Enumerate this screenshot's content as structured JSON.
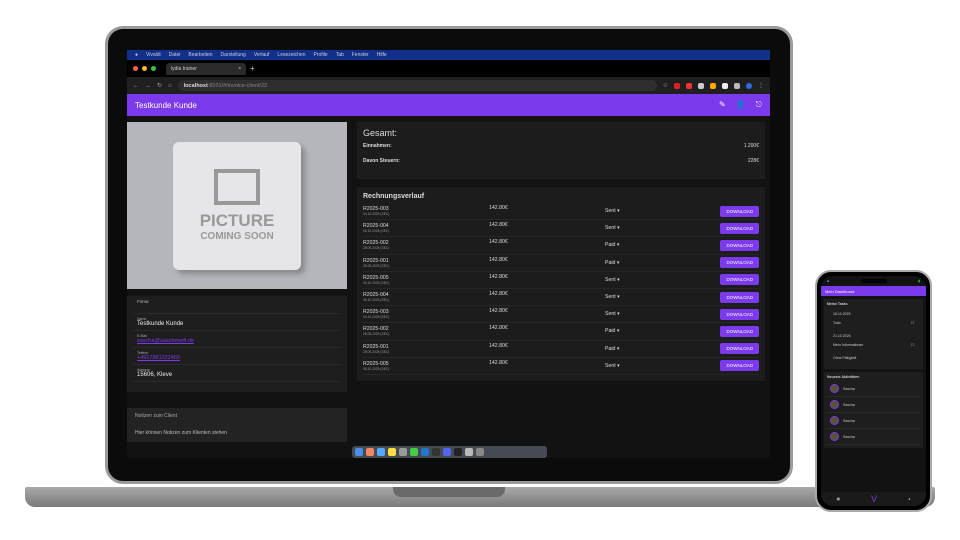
{
  "menubar": {
    "items": [
      "Vivaldi",
      "Datei",
      "Bearbeiten",
      "Darstellung",
      "Verlauf",
      "Lesezeichen",
      "Profile",
      "Tab",
      "Fenster",
      "Hilfe"
    ]
  },
  "browser": {
    "tab_title": "lydia trainer",
    "url_host": "localhost",
    "url_path": ":8101/#/invoice-client/22"
  },
  "app": {
    "title": "Testkunde Kunde",
    "accent": "#7c3aed"
  },
  "client": {
    "picture": {
      "line1": "PICTURE",
      "line2": "COMING SOON"
    },
    "fields": [
      {
        "label": "Firma",
        "value": ""
      },
      {
        "label": "Name",
        "value": "Testkunde Kunde"
      },
      {
        "label": "E-Mail",
        "value": "sascha@saschesoft.de",
        "link": true
      },
      {
        "label": "Telefon",
        "value": "+4917881222465",
        "link": true
      },
      {
        "label": "Adresse",
        "value": "15606, Kleve"
      }
    ],
    "notes": {
      "title": "Notizen zum Client",
      "text": "Hier können Notizen zum Klienten stehen"
    }
  },
  "summary": {
    "title": "Gesamt:",
    "income_label": "Einnahmen:",
    "income_value": "1.200€",
    "tax_label": "Davon Steuern:",
    "tax_value": "228€"
  },
  "history": {
    "title": "Rechnungsverlauf",
    "download_label": "DOWNLOAD",
    "rows": [
      {
        "number": "R2025-003",
        "date": "04.10.2025 (SEC)",
        "amount": "142.80€",
        "status": "Sent"
      },
      {
        "number": "R2025-004",
        "date": "05.10.2025 (SEC)",
        "amount": "142.80€",
        "status": "Sent"
      },
      {
        "number": "R2025-002",
        "date": "28.09.2025 (SEC)",
        "amount": "142.80€",
        "status": "Paid"
      },
      {
        "number": "R2025-001",
        "date": "28.09.2025 (SEC)",
        "amount": "142.80€",
        "status": "Paid"
      },
      {
        "number": "R2025-005",
        "date": "05.10.2025 (SEC)",
        "amount": "142.80€",
        "status": "Sent"
      },
      {
        "number": "R2025-004",
        "date": "05.10.2025 (SEC)",
        "amount": "142.80€",
        "status": "Sent"
      },
      {
        "number": "R2025-003",
        "date": "04.10.2025 (SEC)",
        "amount": "142.80€",
        "status": "Sent"
      },
      {
        "number": "R2025-002",
        "date": "28.09.2025 (SEC)",
        "amount": "142.80€",
        "status": "Paid"
      },
      {
        "number": "R2025-001",
        "date": "28.09.2025 (SEC)",
        "amount": "142.80€",
        "status": "Paid"
      },
      {
        "number": "R2025-005",
        "date": "05.10.2025 (SEC)",
        "amount": "142.80€",
        "status": "Sent"
      }
    ]
  },
  "phone": {
    "title": "Mein Dashboard",
    "section": "Meine Tasks",
    "date1": "16.10.2025",
    "task1": "Todo",
    "date2": "21.10.2025",
    "task2": "Mehr Informationen",
    "empty": "Ohne Fälligkeit",
    "activities_title": "Neueste Aktivitäten",
    "activity_name": "Sascha"
  }
}
